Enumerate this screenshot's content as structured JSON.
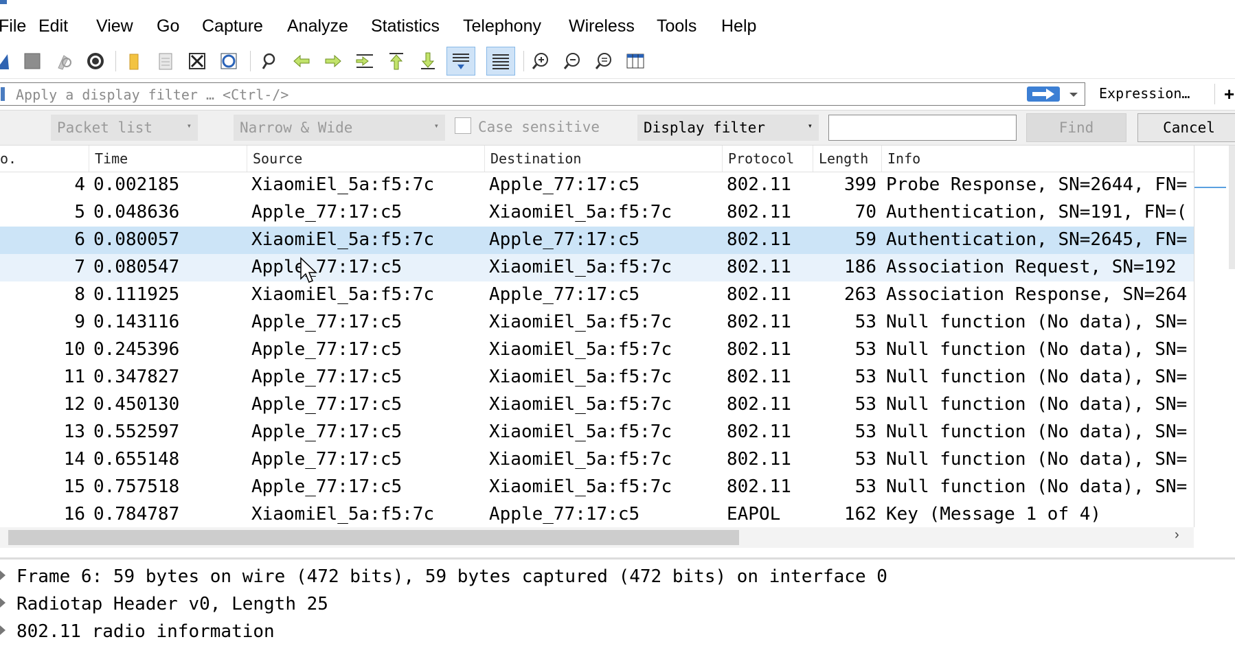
{
  "menu": [
    "File",
    "Edit",
    "View",
    "Go",
    "Capture",
    "Analyze",
    "Statistics",
    "Telephony",
    "Wireless",
    "Tools",
    "Help"
  ],
  "toolbar": {
    "icons": [
      "shark-fin-icon",
      "stop-icon",
      "restart-icon",
      "options-gear-icon",
      "open-folder-icon",
      "save-file-icon",
      "close-file-icon",
      "reload-icon",
      "find-packet-icon",
      "go-back-icon",
      "go-forward-icon",
      "go-to-packet-icon",
      "first-packet-icon",
      "last-packet-icon",
      "autoscroll-icon",
      "colorize-icon",
      "zoom-in-icon",
      "zoom-out-icon",
      "normal-size-icon",
      "resize-columns-icon"
    ]
  },
  "filter": {
    "placeholder": "Apply a display filter … <Ctrl-/>",
    "expression_label": "Expression…",
    "plus_label": "+"
  },
  "findbar": {
    "search_in": "Packet list",
    "char_width": "Narrow & Wide",
    "case_sensitive_label": "Case sensitive",
    "search_type": "Display filter",
    "find_label": "Find",
    "cancel_label": "Cancel"
  },
  "columns": [
    "o.",
    "Time",
    "Source",
    "Destination",
    "Protocol",
    "Length",
    "Info"
  ],
  "packets": [
    {
      "no": "4",
      "time": "0.002185",
      "src": "XiaomiEl_5a:f5:7c",
      "dst": "Apple_77:17:c5",
      "proto": "802.11",
      "len": "399",
      "info": "Probe Response, SN=2644, FN="
    },
    {
      "no": "5",
      "time": "0.048636",
      "src": "Apple_77:17:c5",
      "dst": "XiaomiEl_5a:f5:7c",
      "proto": "802.11",
      "len": "70",
      "info": "Authentication, SN=191, FN=("
    },
    {
      "no": "6",
      "time": "0.080057",
      "src": "XiaomiEl_5a:f5:7c",
      "dst": "Apple_77:17:c5",
      "proto": "802.11",
      "len": "59",
      "info": "Authentication, SN=2645, FN="
    },
    {
      "no": "7",
      "time": "0.080547",
      "src": "Apple_77:17:c5",
      "dst": "XiaomiEl_5a:f5:7c",
      "proto": "802.11",
      "len": "186",
      "info": "Association Request, SN=192"
    },
    {
      "no": "8",
      "time": "0.111925",
      "src": "XiaomiEl_5a:f5:7c",
      "dst": "Apple_77:17:c5",
      "proto": "802.11",
      "len": "263",
      "info": "Association Response, SN=264"
    },
    {
      "no": "9",
      "time": "0.143116",
      "src": "Apple_77:17:c5",
      "dst": "XiaomiEl_5a:f5:7c",
      "proto": "802.11",
      "len": "53",
      "info": "Null function (No data), SN="
    },
    {
      "no": "10",
      "time": "0.245396",
      "src": "Apple_77:17:c5",
      "dst": "XiaomiEl_5a:f5:7c",
      "proto": "802.11",
      "len": "53",
      "info": "Null function (No data), SN="
    },
    {
      "no": "11",
      "time": "0.347827",
      "src": "Apple_77:17:c5",
      "dst": "XiaomiEl_5a:f5:7c",
      "proto": "802.11",
      "len": "53",
      "info": "Null function (No data), SN="
    },
    {
      "no": "12",
      "time": "0.450130",
      "src": "Apple_77:17:c5",
      "dst": "XiaomiEl_5a:f5:7c",
      "proto": "802.11",
      "len": "53",
      "info": "Null function (No data), SN="
    },
    {
      "no": "13",
      "time": "0.552597",
      "src": "Apple_77:17:c5",
      "dst": "XiaomiEl_5a:f5:7c",
      "proto": "802.11",
      "len": "53",
      "info": "Null function (No data), SN="
    },
    {
      "no": "14",
      "time": "0.655148",
      "src": "Apple_77:17:c5",
      "dst": "XiaomiEl_5a:f5:7c",
      "proto": "802.11",
      "len": "53",
      "info": "Null function (No data), SN="
    },
    {
      "no": "15",
      "time": "0.757518",
      "src": "Apple_77:17:c5",
      "dst": "XiaomiEl_5a:f5:7c",
      "proto": "802.11",
      "len": "53",
      "info": "Null function (No data), SN="
    },
    {
      "no": "16",
      "time": "0.784787",
      "src": "XiaomiEl_5a:f5:7c",
      "dst": "Apple_77:17:c5",
      "proto": "EAPOL",
      "len": "162",
      "info": "Key (Message 1 of 4)"
    }
  ],
  "selected_packet": "6",
  "details": [
    "Frame 6: 59 bytes on wire (472 bits), 59 bytes captured (472 bits) on interface 0",
    "Radiotap Header v0, Length 25",
    "802.11 radio information"
  ],
  "colors": {
    "selected_row": "#cce4f7",
    "hover_row": "#e8f2fb",
    "apply_button": "#3c7fd4"
  }
}
